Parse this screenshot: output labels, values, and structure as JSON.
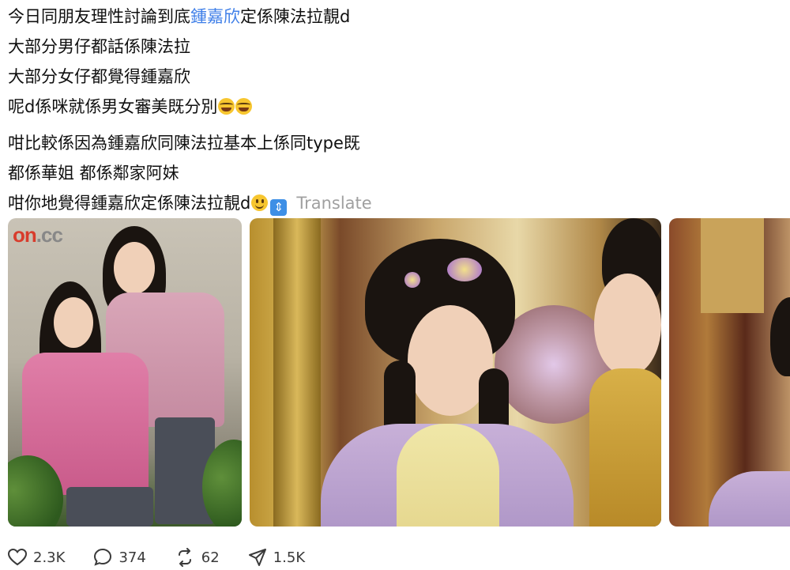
{
  "post": {
    "lines": [
      {
        "before": "今日同朋友理性討論到底",
        "mention": "鍾嘉欣",
        "after": "定係陳法拉靚d"
      },
      {
        "text": "大部分男仔都話係陳法拉"
      },
      {
        "text": "大部分女仔都覺得鍾嘉欣"
      },
      {
        "text": "呢d係咪就係男女審美既分別"
      },
      {
        "text": "咁比較係因為鍾嘉欣同陳法拉基本上係同type既"
      },
      {
        "text": "都係華姐 都係鄰家阿妹"
      },
      {
        "text": "咁你地覺得鍾嘉欣定係陳法拉靚d"
      }
    ],
    "translate_label": "Translate",
    "emojis": [
      "laughing-crying-emoji",
      "laughing-crying-emoji",
      "smiling-emoji",
      "up-down-arrow-emoji"
    ]
  },
  "media": {
    "watermark": {
      "brand": "on",
      "suffix": ".cc"
    },
    "images": [
      "photo-two-women-pink-jackets",
      "photo-period-drama-actress",
      "photo-period-drama-partial"
    ]
  },
  "actions": {
    "likes": "2.3K",
    "replies": "374",
    "reposts": "62",
    "shares": "1.5K"
  },
  "colors": {
    "mention": "#3f7fe8",
    "translate": "#a0a0a0",
    "text": "#101010"
  }
}
